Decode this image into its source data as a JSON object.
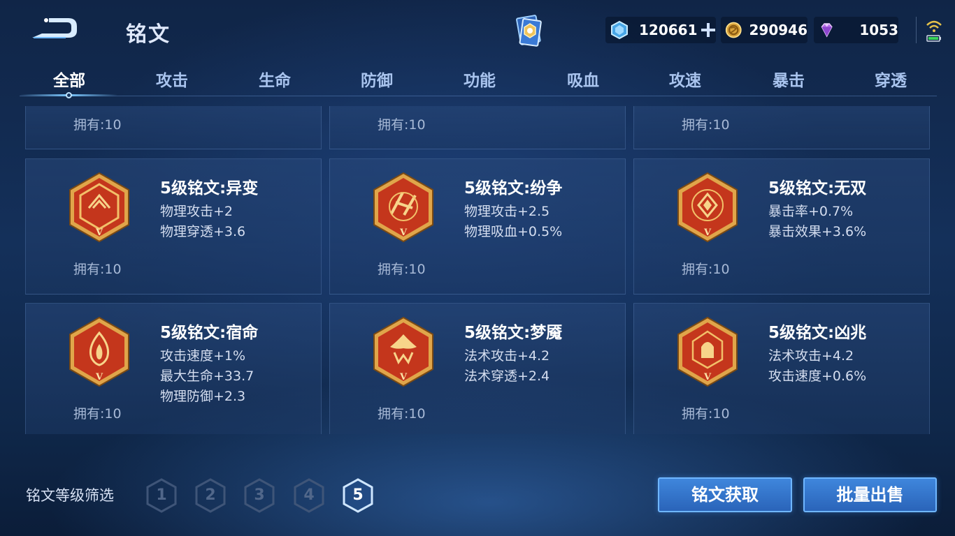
{
  "header": {
    "title": "铭文",
    "currencies": [
      {
        "name": "crystal-coupon",
        "value": "120661"
      },
      {
        "name": "gold",
        "value": "290946"
      },
      {
        "name": "diamond",
        "value": "1053"
      }
    ]
  },
  "tabs": [
    {
      "label": "全部",
      "active": true
    },
    {
      "label": "攻击"
    },
    {
      "label": "生命"
    },
    {
      "label": "防御"
    },
    {
      "label": "功能"
    },
    {
      "label": "吸血"
    },
    {
      "label": "攻速"
    },
    {
      "label": "暴击"
    },
    {
      "label": "穿透"
    }
  ],
  "cards_partial": [
    {
      "owned": "拥有:10"
    },
    {
      "owned": "拥有:10"
    },
    {
      "owned": "拥有:10"
    }
  ],
  "cards": [
    {
      "name": "5级铭文:异变",
      "stats": [
        "物理攻击+2",
        "物理穿透+3.6"
      ],
      "owned": "拥有:10",
      "icon": "rune-yibian-icon"
    },
    {
      "name": "5级铭文:纷争",
      "stats": [
        "物理攻击+2.5",
        "物理吸血+0.5%"
      ],
      "owned": "拥有:10",
      "icon": "rune-fenzheng-icon"
    },
    {
      "name": "5级铭文:无双",
      "stats": [
        "暴击率+0.7%",
        "暴击效果+3.6%"
      ],
      "owned": "拥有:10",
      "icon": "rune-wushuang-icon"
    },
    {
      "name": "5级铭文:宿命",
      "stats": [
        "攻击速度+1%",
        "最大生命+33.7",
        "物理防御+2.3"
      ],
      "owned": "拥有:10",
      "icon": "rune-suming-icon"
    },
    {
      "name": "5级铭文:梦魇",
      "stats": [
        "法术攻击+4.2",
        "法术穿透+2.4"
      ],
      "owned": "拥有:10",
      "icon": "rune-mengyan-icon"
    },
    {
      "name": "5级铭文:凶兆",
      "stats": [
        "法术攻击+4.2",
        "攻击速度+0.6%"
      ],
      "owned": "拥有:10",
      "icon": "rune-xiongzhao-icon"
    }
  ],
  "filter": {
    "label": "铭文等级筛选",
    "levels": [
      "1",
      "2",
      "3",
      "4",
      "5"
    ],
    "selected": "5"
  },
  "buttons": {
    "get": "铭文获取",
    "sell": "批量出售"
  },
  "badge_letter": "V",
  "colors": {
    "rune_red": "#c4361c",
    "rune_gold": "#e0a54a",
    "button_blue": "#2f6fc6",
    "accent_cyan": "#7cc8ff"
  }
}
